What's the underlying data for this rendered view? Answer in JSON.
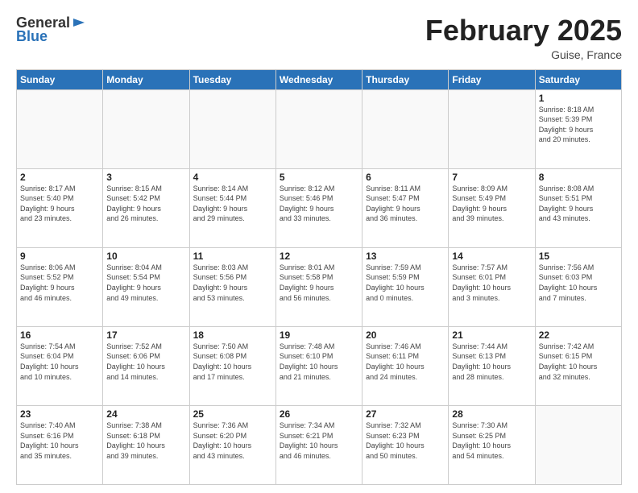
{
  "header": {
    "logo": {
      "general": "General",
      "blue": "Blue"
    },
    "month": "February 2025",
    "location": "Guise, France"
  },
  "weekdays": [
    "Sunday",
    "Monday",
    "Tuesday",
    "Wednesday",
    "Thursday",
    "Friday",
    "Saturday"
  ],
  "weeks": [
    [
      {
        "day": null,
        "info": ""
      },
      {
        "day": null,
        "info": ""
      },
      {
        "day": null,
        "info": ""
      },
      {
        "day": null,
        "info": ""
      },
      {
        "day": null,
        "info": ""
      },
      {
        "day": null,
        "info": ""
      },
      {
        "day": "1",
        "info": "Sunrise: 8:18 AM\nSunset: 5:39 PM\nDaylight: 9 hours\nand 20 minutes."
      }
    ],
    [
      {
        "day": "2",
        "info": "Sunrise: 8:17 AM\nSunset: 5:40 PM\nDaylight: 9 hours\nand 23 minutes."
      },
      {
        "day": "3",
        "info": "Sunrise: 8:15 AM\nSunset: 5:42 PM\nDaylight: 9 hours\nand 26 minutes."
      },
      {
        "day": "4",
        "info": "Sunrise: 8:14 AM\nSunset: 5:44 PM\nDaylight: 9 hours\nand 29 minutes."
      },
      {
        "day": "5",
        "info": "Sunrise: 8:12 AM\nSunset: 5:46 PM\nDaylight: 9 hours\nand 33 minutes."
      },
      {
        "day": "6",
        "info": "Sunrise: 8:11 AM\nSunset: 5:47 PM\nDaylight: 9 hours\nand 36 minutes."
      },
      {
        "day": "7",
        "info": "Sunrise: 8:09 AM\nSunset: 5:49 PM\nDaylight: 9 hours\nand 39 minutes."
      },
      {
        "day": "8",
        "info": "Sunrise: 8:08 AM\nSunset: 5:51 PM\nDaylight: 9 hours\nand 43 minutes."
      }
    ],
    [
      {
        "day": "9",
        "info": "Sunrise: 8:06 AM\nSunset: 5:52 PM\nDaylight: 9 hours\nand 46 minutes."
      },
      {
        "day": "10",
        "info": "Sunrise: 8:04 AM\nSunset: 5:54 PM\nDaylight: 9 hours\nand 49 minutes."
      },
      {
        "day": "11",
        "info": "Sunrise: 8:03 AM\nSunset: 5:56 PM\nDaylight: 9 hours\nand 53 minutes."
      },
      {
        "day": "12",
        "info": "Sunrise: 8:01 AM\nSunset: 5:58 PM\nDaylight: 9 hours\nand 56 minutes."
      },
      {
        "day": "13",
        "info": "Sunrise: 7:59 AM\nSunset: 5:59 PM\nDaylight: 10 hours\nand 0 minutes."
      },
      {
        "day": "14",
        "info": "Sunrise: 7:57 AM\nSunset: 6:01 PM\nDaylight: 10 hours\nand 3 minutes."
      },
      {
        "day": "15",
        "info": "Sunrise: 7:56 AM\nSunset: 6:03 PM\nDaylight: 10 hours\nand 7 minutes."
      }
    ],
    [
      {
        "day": "16",
        "info": "Sunrise: 7:54 AM\nSunset: 6:04 PM\nDaylight: 10 hours\nand 10 minutes."
      },
      {
        "day": "17",
        "info": "Sunrise: 7:52 AM\nSunset: 6:06 PM\nDaylight: 10 hours\nand 14 minutes."
      },
      {
        "day": "18",
        "info": "Sunrise: 7:50 AM\nSunset: 6:08 PM\nDaylight: 10 hours\nand 17 minutes."
      },
      {
        "day": "19",
        "info": "Sunrise: 7:48 AM\nSunset: 6:10 PM\nDaylight: 10 hours\nand 21 minutes."
      },
      {
        "day": "20",
        "info": "Sunrise: 7:46 AM\nSunset: 6:11 PM\nDaylight: 10 hours\nand 24 minutes."
      },
      {
        "day": "21",
        "info": "Sunrise: 7:44 AM\nSunset: 6:13 PM\nDaylight: 10 hours\nand 28 minutes."
      },
      {
        "day": "22",
        "info": "Sunrise: 7:42 AM\nSunset: 6:15 PM\nDaylight: 10 hours\nand 32 minutes."
      }
    ],
    [
      {
        "day": "23",
        "info": "Sunrise: 7:40 AM\nSunset: 6:16 PM\nDaylight: 10 hours\nand 35 minutes."
      },
      {
        "day": "24",
        "info": "Sunrise: 7:38 AM\nSunset: 6:18 PM\nDaylight: 10 hours\nand 39 minutes."
      },
      {
        "day": "25",
        "info": "Sunrise: 7:36 AM\nSunset: 6:20 PM\nDaylight: 10 hours\nand 43 minutes."
      },
      {
        "day": "26",
        "info": "Sunrise: 7:34 AM\nSunset: 6:21 PM\nDaylight: 10 hours\nand 46 minutes."
      },
      {
        "day": "27",
        "info": "Sunrise: 7:32 AM\nSunset: 6:23 PM\nDaylight: 10 hours\nand 50 minutes."
      },
      {
        "day": "28",
        "info": "Sunrise: 7:30 AM\nSunset: 6:25 PM\nDaylight: 10 hours\nand 54 minutes."
      },
      {
        "day": null,
        "info": ""
      }
    ]
  ]
}
